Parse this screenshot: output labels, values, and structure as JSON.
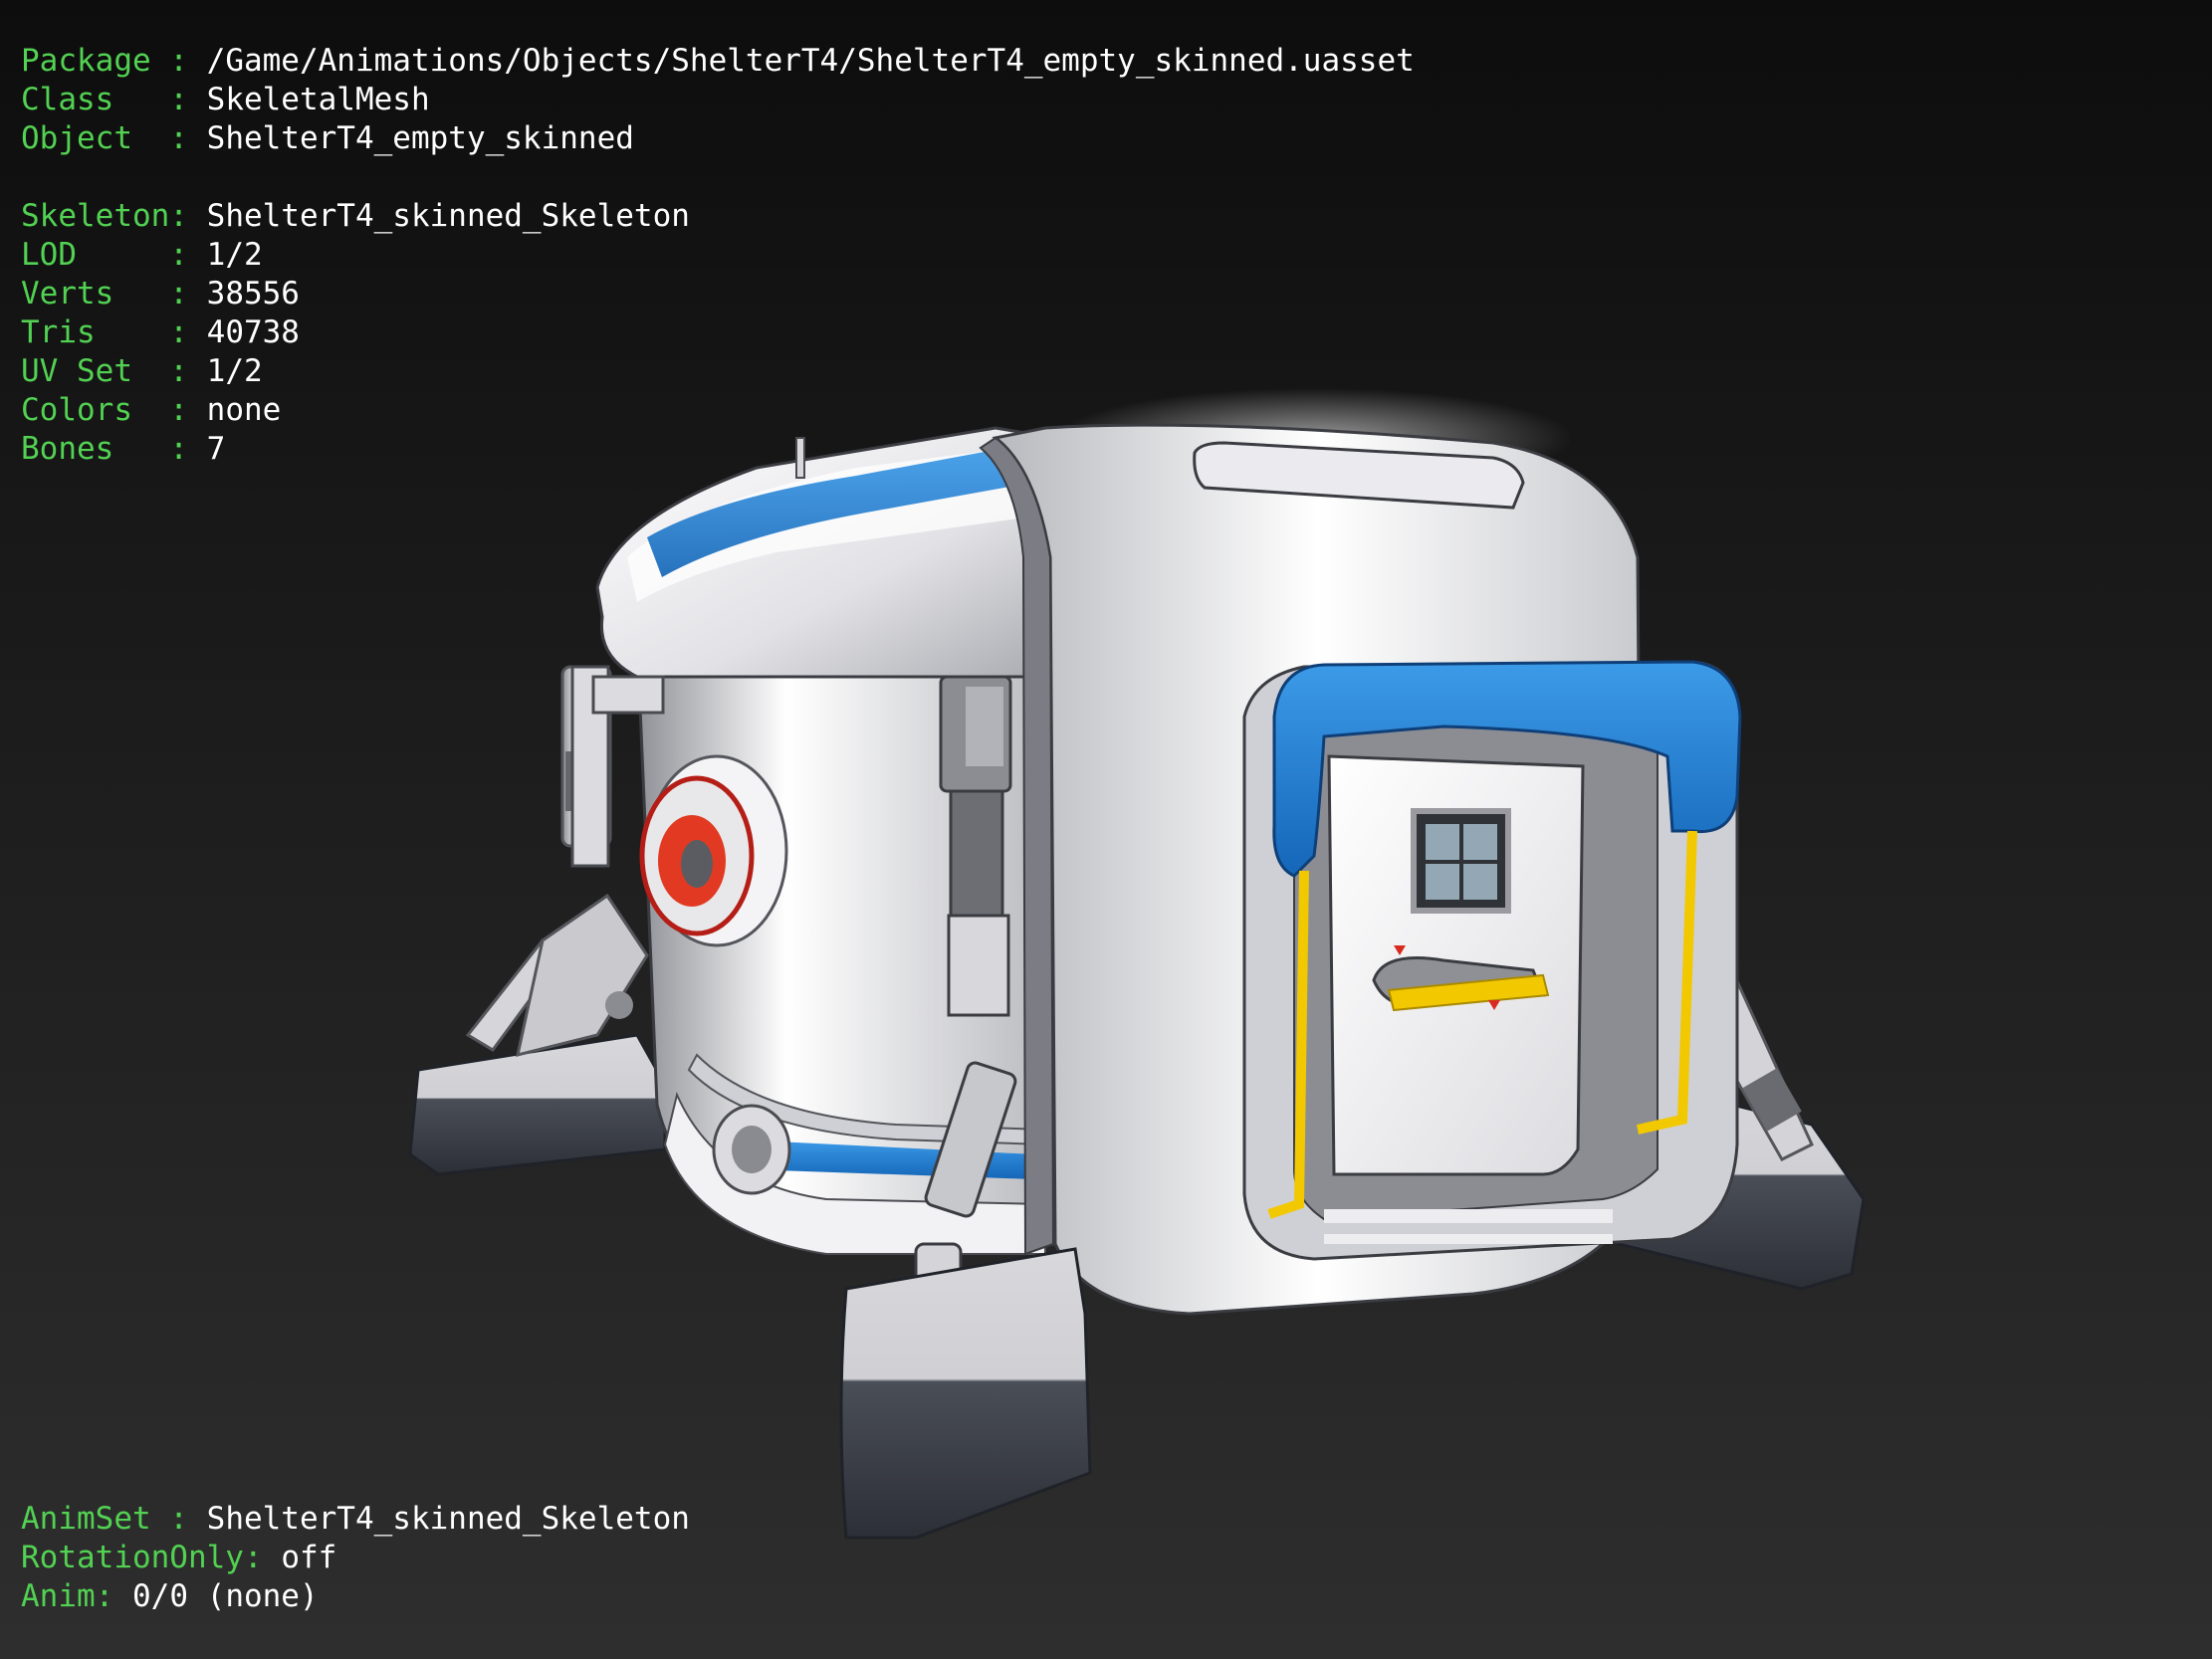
{
  "info": {
    "package_key": "Package :",
    "package": "/Game/Animations/Objects/ShelterT4/ShelterT4_empty_skinned.uasset",
    "class_key": "Class   :",
    "class": "SkeletalMesh",
    "object_key": "Object  :",
    "object": "ShelterT4_empty_skinned",
    "skeleton_key": "Skeleton:",
    "skeleton": "ShelterT4_skinned_Skeleton",
    "lod_key": "LOD     :",
    "lod": "1/2",
    "verts_key": "Verts   :",
    "verts": "38556",
    "tris_key": "Tris    :",
    "tris": "40738",
    "uvset_key": "UV Set  :",
    "uvset": "1/2",
    "colors_key": "Colors  :",
    "colors": "none",
    "bones_key": "Bones   :",
    "bones": "7"
  },
  "anim": {
    "animset_key": "AnimSet :",
    "animset": "ShelterT4_skinned_Skeleton",
    "rotation_key": "RotationOnly:",
    "rotation": "off",
    "anim_key": "Anim:",
    "anim": "0/0 (none)"
  },
  "colors": {
    "label": "#52d152",
    "value": "#ffffff",
    "shell": "#e4e4e8",
    "stripe": "#1c78c8",
    "rail": "#f2c800",
    "pad": "#3a3e46"
  }
}
